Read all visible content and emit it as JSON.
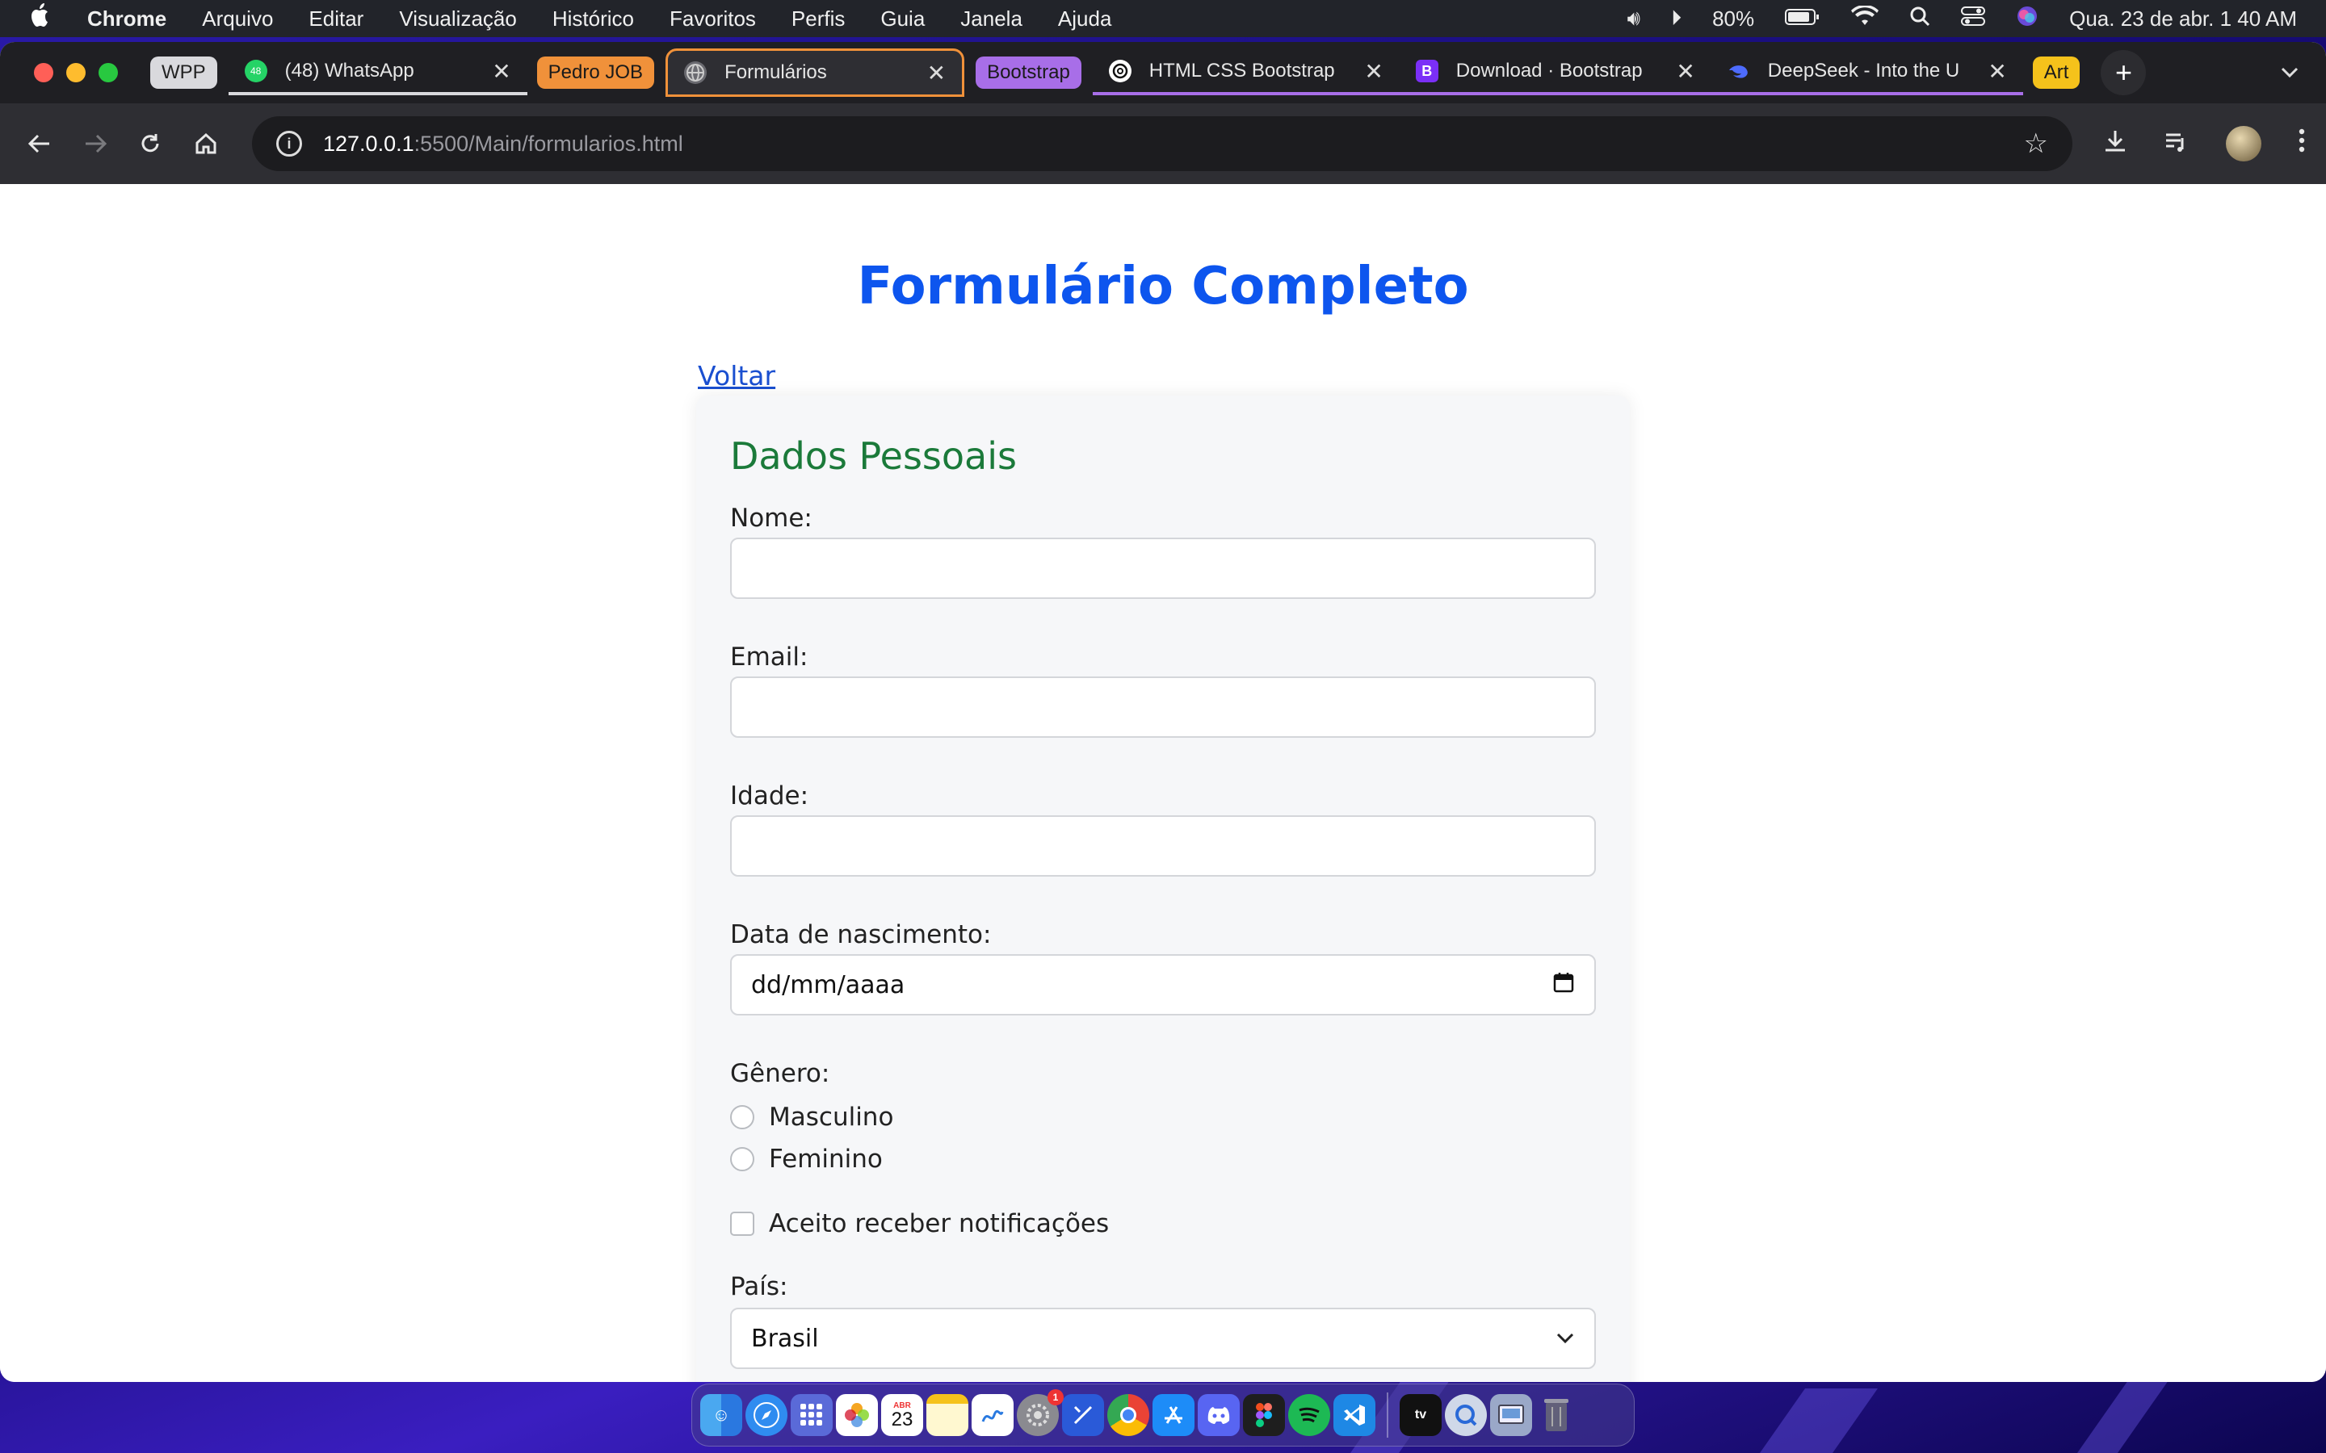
{
  "menubar": {
    "app_name": "Chrome",
    "items": [
      "Arquivo",
      "Editar",
      "Visualização",
      "Histórico",
      "Favoritos",
      "Perfis",
      "Guia",
      "Janela",
      "Ajuda"
    ],
    "battery": "80%",
    "datetime": "Qua. 23 de abr.  1 40 AM"
  },
  "tabs": {
    "groups": [
      {
        "label": "WPP",
        "color": "#d9d9dd",
        "text_color": "#222222"
      },
      {
        "label": "Pedro JOB",
        "color": "#f0913a",
        "text_color": "#1a1a1a"
      },
      {
        "label": "Bootstrap",
        "color": "#a86ee8",
        "text_color": "#1a1a1a"
      },
      {
        "label": "Art",
        "color": "#f5c21b",
        "text_color": "#1a1a1a"
      }
    ],
    "items": [
      {
        "title": "(48) WhatsApp",
        "icon": "whatsapp-icon",
        "badge": "48"
      },
      {
        "title": "Formulários",
        "icon": "globe-icon",
        "active": true
      },
      {
        "title": "HTML CSS Bootstrap",
        "icon": "openai-icon"
      },
      {
        "title": "Download · Bootstrap",
        "icon": "bootstrap-icon",
        "glyph": "B"
      },
      {
        "title": "DeepSeek - Into the U",
        "icon": "deepseek-icon"
      }
    ]
  },
  "toolbar": {
    "url_host": "127.0.0.1",
    "url_rest": ":5500/Main/formularios.html"
  },
  "page": {
    "title": "Formulário Completo",
    "back_link": "Voltar",
    "section_title": "Dados Pessoais",
    "fields": {
      "nome_label": "Nome:",
      "email_label": "Email:",
      "idade_label": "Idade:",
      "nascimento_label": "Data de nascimento:",
      "nascimento_placeholder": "dd/mm/aaaa",
      "genero_label": "Gênero:",
      "genero_options": [
        "Masculino",
        "Feminino"
      ],
      "notificacoes_label": "Aceito receber notificações",
      "pais_label": "País:",
      "pais_selected": "Brasil"
    }
  },
  "dock": {
    "calendar_month": "ABR",
    "calendar_day": "23",
    "settings_badge": "1"
  }
}
